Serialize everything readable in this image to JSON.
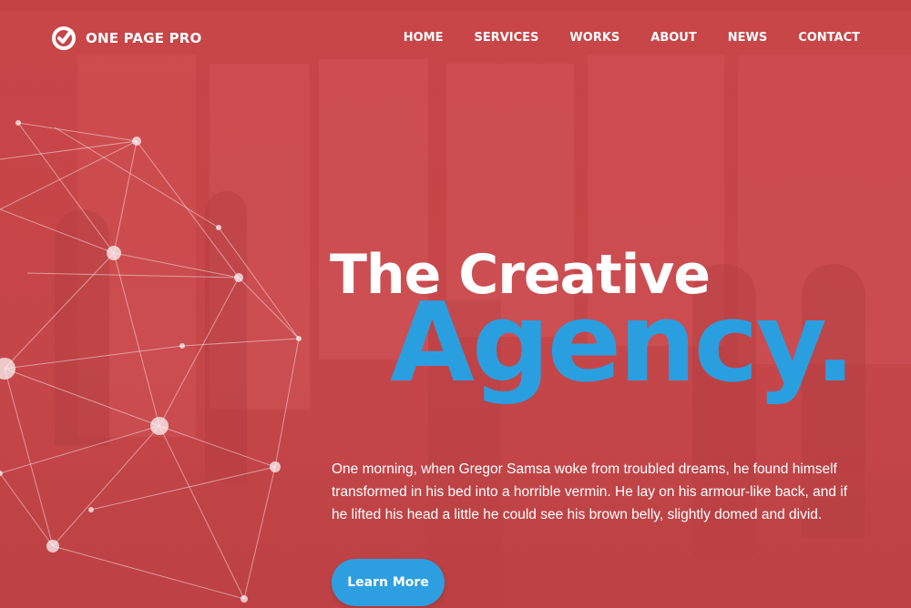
{
  "brand": {
    "name": "ONE PAGE PRO",
    "logo_icon": "circle-check-logo-icon"
  },
  "nav": {
    "items": [
      "HOME",
      "SERVICES",
      "WORKS",
      "ABOUT",
      "NEWS",
      "CONTACT"
    ]
  },
  "hero": {
    "title_line1": "The Creative",
    "title_line2": "Agency.",
    "description": "One morning, when Gregor Samsa woke from troubled dreams, he found himself transformed in his bed into a horrible vermin. He lay on his armour-like back, and if he lifted his head a little he could see his brown belly, slightly domed and divid.",
    "cta_label": "Learn More"
  },
  "colors": {
    "overlay_red": "#c8494c",
    "accent_blue": "#2a9fe0",
    "text_white": "#ffffff"
  }
}
